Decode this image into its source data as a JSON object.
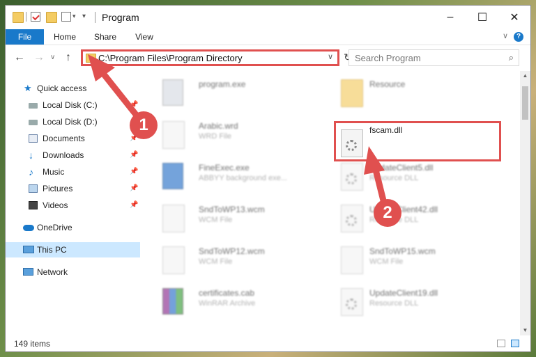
{
  "window": {
    "title": "Program",
    "minimize_glyph": "–",
    "maximize_glyph": "☐",
    "close_glyph": "✕"
  },
  "ribbon": {
    "tabs": [
      "File",
      "Home",
      "Share",
      "View"
    ],
    "help_glyph": "?",
    "expand_glyph": "∨"
  },
  "nav": {
    "back_glyph": "←",
    "forward_glyph": "→",
    "recent_glyph": "∨",
    "up_glyph": "↑",
    "address_path": "C:\\Program Files\\Program Directory",
    "address_dropdown_glyph": "∨",
    "refresh_glyph": "↻",
    "search_placeholder": "Search Program",
    "search_glyph": "⌕"
  },
  "sidebar": {
    "items": [
      {
        "label": "Quick access",
        "icon": "star-icon"
      },
      {
        "label": "Local Disk (C:)",
        "icon": "drive-icon"
      },
      {
        "label": "Local Disk (D:)",
        "icon": "drive-icon"
      },
      {
        "label": "Documents",
        "icon": "documents-icon"
      },
      {
        "label": "Downloads",
        "icon": "download-icon"
      },
      {
        "label": "Music",
        "icon": "music-icon"
      },
      {
        "label": "Pictures",
        "icon": "pictures-icon"
      },
      {
        "label": "Videos",
        "icon": "videos-icon"
      },
      {
        "label": "OneDrive",
        "icon": "cloud-icon"
      },
      {
        "label": "This PC",
        "icon": "computer-icon"
      },
      {
        "label": "Network",
        "icon": "network-icon"
      }
    ],
    "pin_glyph": "📌"
  },
  "files": {
    "left": [
      {
        "name": "program.exe",
        "type": ""
      },
      {
        "name": "Arabic.wrd",
        "type": "WRD File"
      },
      {
        "name": "FineExec.exe",
        "type": "ABBYY background exe..."
      },
      {
        "name": "SndToWP13.wcm",
        "type": "WCM File"
      },
      {
        "name": "SndToWP12.wcm",
        "type": "WCM File"
      },
      {
        "name": "certificates.cab",
        "type": "WinRAR Archive"
      }
    ],
    "right": [
      {
        "name": "Resource",
        "type": ""
      },
      {
        "name": "fscam.dll",
        "type": ""
      },
      {
        "name": "UpdateClient5.dll",
        "type": "Resource DLL"
      },
      {
        "name": "UpdateClient42.dll",
        "type": "Resource DLL"
      },
      {
        "name": "SndToWP15.wcm",
        "type": "WCM File"
      },
      {
        "name": "UpdateClient19.dll",
        "type": "Resource DLL"
      }
    ]
  },
  "status": {
    "item_count": "149 items"
  },
  "annotations": {
    "step1": "1",
    "step2": "2",
    "color": "#e0504f"
  }
}
